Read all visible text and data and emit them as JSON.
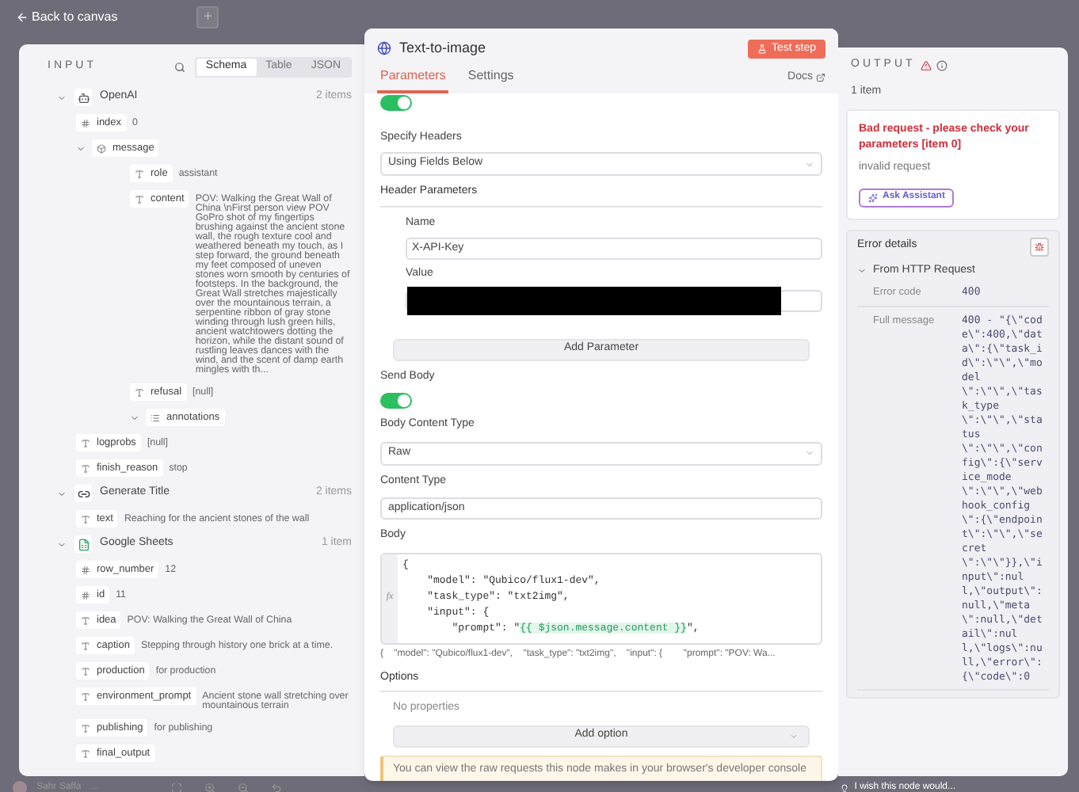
{
  "canvas": {
    "back_label": "Back to canvas",
    "add_label": "+",
    "user_name": "Sahr Saffa",
    "user_menu": "...",
    "feedback": "I wish this node would..."
  },
  "input": {
    "title": "INPUT",
    "views": [
      {
        "label": "Schema",
        "selected": true
      },
      {
        "label": "Table",
        "selected": false
      },
      {
        "label": "JSON",
        "selected": false
      }
    ],
    "sections": [
      {
        "name": "OpenAI",
        "kind": "ai",
        "count": "2 items",
        "expanded": true,
        "fields": [
          {
            "kind": "number",
            "key": "index",
            "value": "0"
          },
          {
            "kind": "object",
            "key": "message",
            "expanded": true,
            "children": [
              {
                "kind": "string",
                "key": "role",
                "value": "assistant"
              },
              {
                "kind": "string",
                "key": "content",
                "value": "POV: Walking the Great Wall of China \\nFirst person view POV GoPro shot of my fingertips brushing against the ancient stone wall, the rough texture cool and weathered beneath my touch, as I step forward, the ground beneath my feet composed of uneven stones worn smooth by centuries of footsteps. In the background, the Great Wall stretches majestically over the mountainous terrain, a serpentine ribbon of gray stone winding through lush green hills, ancient watchtowers dotting the horizon, while the distant sound of rustling leaves dances with the wind, and the scent of damp earth mingles with th..."
              },
              {
                "kind": "string",
                "key": "refusal",
                "value": "[null]"
              },
              {
                "kind": "array",
                "key": "annotations",
                "expanded": true
              }
            ]
          },
          {
            "kind": "string",
            "key": "logprobs",
            "value": "[null]"
          },
          {
            "kind": "string",
            "key": "finish_reason",
            "value": "stop"
          }
        ]
      },
      {
        "name": "Generate Title",
        "kind": "link",
        "count": "2 items",
        "expanded": true,
        "fields": [
          {
            "kind": "string",
            "key": "text",
            "value": "Reaching for the ancient stones of the wall"
          }
        ]
      },
      {
        "name": "Google Sheets",
        "kind": "sheet",
        "count": "1 item",
        "expanded": true,
        "fields": [
          {
            "kind": "number",
            "key": "row_number",
            "value": "12"
          },
          {
            "kind": "number",
            "key": "id",
            "value": "11"
          },
          {
            "kind": "string",
            "key": "idea",
            "value": "POV: Walking the Great Wall of China"
          },
          {
            "kind": "string",
            "key": "caption",
            "value": "Stepping through history one brick at a time."
          },
          {
            "kind": "string",
            "key": "production",
            "value": "for production"
          },
          {
            "kind": "string",
            "key": "environment_prompt",
            "value": "Ancient stone wall stretching over mountainous terrain"
          },
          {
            "kind": "string",
            "key": "publishing",
            "value": "for publishing"
          },
          {
            "kind": "string",
            "key": "final_output"
          }
        ]
      }
    ]
  },
  "node": {
    "title": "Text-to-image",
    "test_button": "Test step",
    "tabs": [
      {
        "label": "Parameters",
        "selected": true
      },
      {
        "label": "Settings",
        "selected": false
      }
    ],
    "docs": "Docs",
    "top_toggle_on": true,
    "specify_headers": {
      "label": "Specify Headers",
      "value": "Using Fields Below"
    },
    "header_parameters": {
      "label": "Header Parameters",
      "name_label": "Name",
      "name_value": "X-API-Key",
      "value_label": "Value",
      "add_button": "Add Parameter"
    },
    "send_body": {
      "label": "Send Body",
      "on": true
    },
    "body_content_type": {
      "label": "Body Content Type",
      "value": "Raw"
    },
    "content_type": {
      "label": "Content Type",
      "value": "application/json"
    },
    "body": {
      "label": "Body",
      "fx": "fx",
      "lines": [
        [
          {
            "text": "{",
            "kind": "plain"
          }
        ],
        [
          {
            "text": "    \"model\": \"Qubico/flux1-dev\",",
            "kind": "plain"
          }
        ],
        [
          {
            "text": "    \"task_type\": \"txt2img\",",
            "kind": "plain"
          }
        ],
        [
          {
            "text": "    \"input\": {",
            "kind": "plain"
          }
        ],
        [
          {
            "text": "        \"prompt\": \"",
            "kind": "plain"
          },
          {
            "text": "{{ $json.message.content }}",
            "kind": "expression"
          },
          {
            "text": "\",",
            "kind": "plain"
          }
        ]
      ],
      "preview": "{    \"model\": \"Qubico/flux1-dev\",    \"task_type\": \"txt2img\",    \"input\": {        \"prompt\": \"POV: Wa..."
    },
    "options": {
      "label": "Options",
      "empty": "No properties",
      "add_button": "Add option"
    },
    "notice": "You can view the raw requests this node makes in your browser's developer console"
  },
  "output": {
    "title": "OUTPUT",
    "count": "1 item",
    "error_title": "Bad request - please check your parameters [item 0]",
    "error_subtitle": "invalid request",
    "assistant_button": "Ask Assistant",
    "details_title": "Error details",
    "source": "From HTTP Request",
    "source_expanded": true,
    "rows": [
      {
        "label": "Error code",
        "value": "400"
      },
      {
        "label": "Full message",
        "value": "400 - \"{\\\"code\\\":400,\\\"data\\\":{\\\"task_id\\\":\\\"\\\",\\\"model\\\":\\\"\\\",\\\"task_type\\\":\\\"\\\",\\\"status\\\":\\\"\\\",\\\"config\\\":{\\\"service_mode\\\":\\\"\\\",\\\"webhook_config\\\":{\\\"endpoint\\\":\\\"\\\",\\\"secret\\\":\\\"\\\"}},\\\"input\\\":null,\\\"output\\\":null,\\\"meta\\\":null,\\\"detail\\\":null,\\\"logs\\\":null,\\\"error\\\":{\\\"code\\\":0"
      }
    ]
  }
}
